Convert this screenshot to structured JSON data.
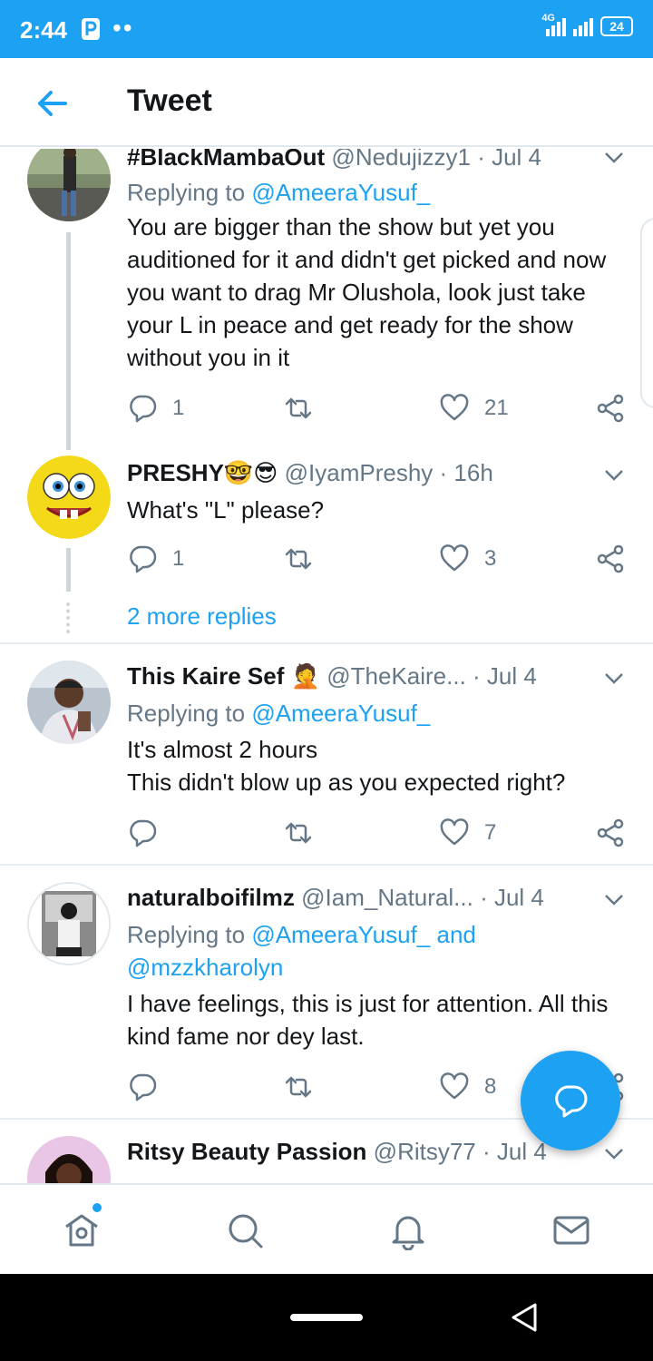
{
  "status_bar": {
    "time": "2:44",
    "network": "4G",
    "battery": "24"
  },
  "header": {
    "title": "Tweet"
  },
  "tweets": [
    {
      "name": "#BlackMambaOut",
      "handle": "@Nedujizzy1",
      "time": "· Jul 4",
      "replying_prefix": "Replying to ",
      "replying_to": "@AmeeraYusuf_",
      "text": "You are bigger than the show but yet you auditioned for it and didn't get picked and now you want to drag Mr Olushola, look just take your L in peace and get ready for the show without you in it",
      "replies": "1",
      "retweets": "",
      "likes": "21"
    },
    {
      "name": "PRESHY",
      "emoji": "🤓😎",
      "handle": "@IyamPreshy",
      "time": "· 16h",
      "text": "What's \"L\" please?",
      "replies": "1",
      "retweets": "",
      "likes": "3"
    },
    {
      "name": "This Kaire Sef",
      "emoji": "🤦",
      "handle": "@TheKaire...",
      "time": "· Jul 4",
      "replying_prefix": "Replying to ",
      "replying_to": "@AmeeraYusuf_",
      "text_line1": "It's almost 2 hours",
      "text_line2": "This didn't blow up as you expected right?",
      "replies": "",
      "retweets": "",
      "likes": "7"
    },
    {
      "name": "naturalboifilmz",
      "handle": "@Iam_Natural...",
      "time": "· Jul 4",
      "replying_prefix": "Replying to ",
      "replying_to": "@AmeeraYusuf_",
      "replying_and": " and",
      "replying_to_2": "@mzzkharolyn",
      "text": "I have feelings, this is just for attention. All this kind fame nor dey last.",
      "replies": "",
      "retweets": "",
      "likes": "8"
    },
    {
      "name": "Ritsy Beauty Passion",
      "handle": "@Ritsy77",
      "time": "· Jul 4"
    }
  ],
  "more_replies": "2 more replies",
  "colors": {
    "brand": "#1da1f2",
    "text": "#14171a",
    "muted": "#657786"
  },
  "icons": {
    "back": "back-arrow-icon",
    "reply": "reply-icon",
    "retweet": "retweet-icon",
    "like": "heart-icon",
    "share": "share-icon",
    "compose": "compose-reply-icon",
    "home": "home-icon",
    "search": "search-icon",
    "notifications": "bell-icon",
    "messages": "mail-icon"
  }
}
